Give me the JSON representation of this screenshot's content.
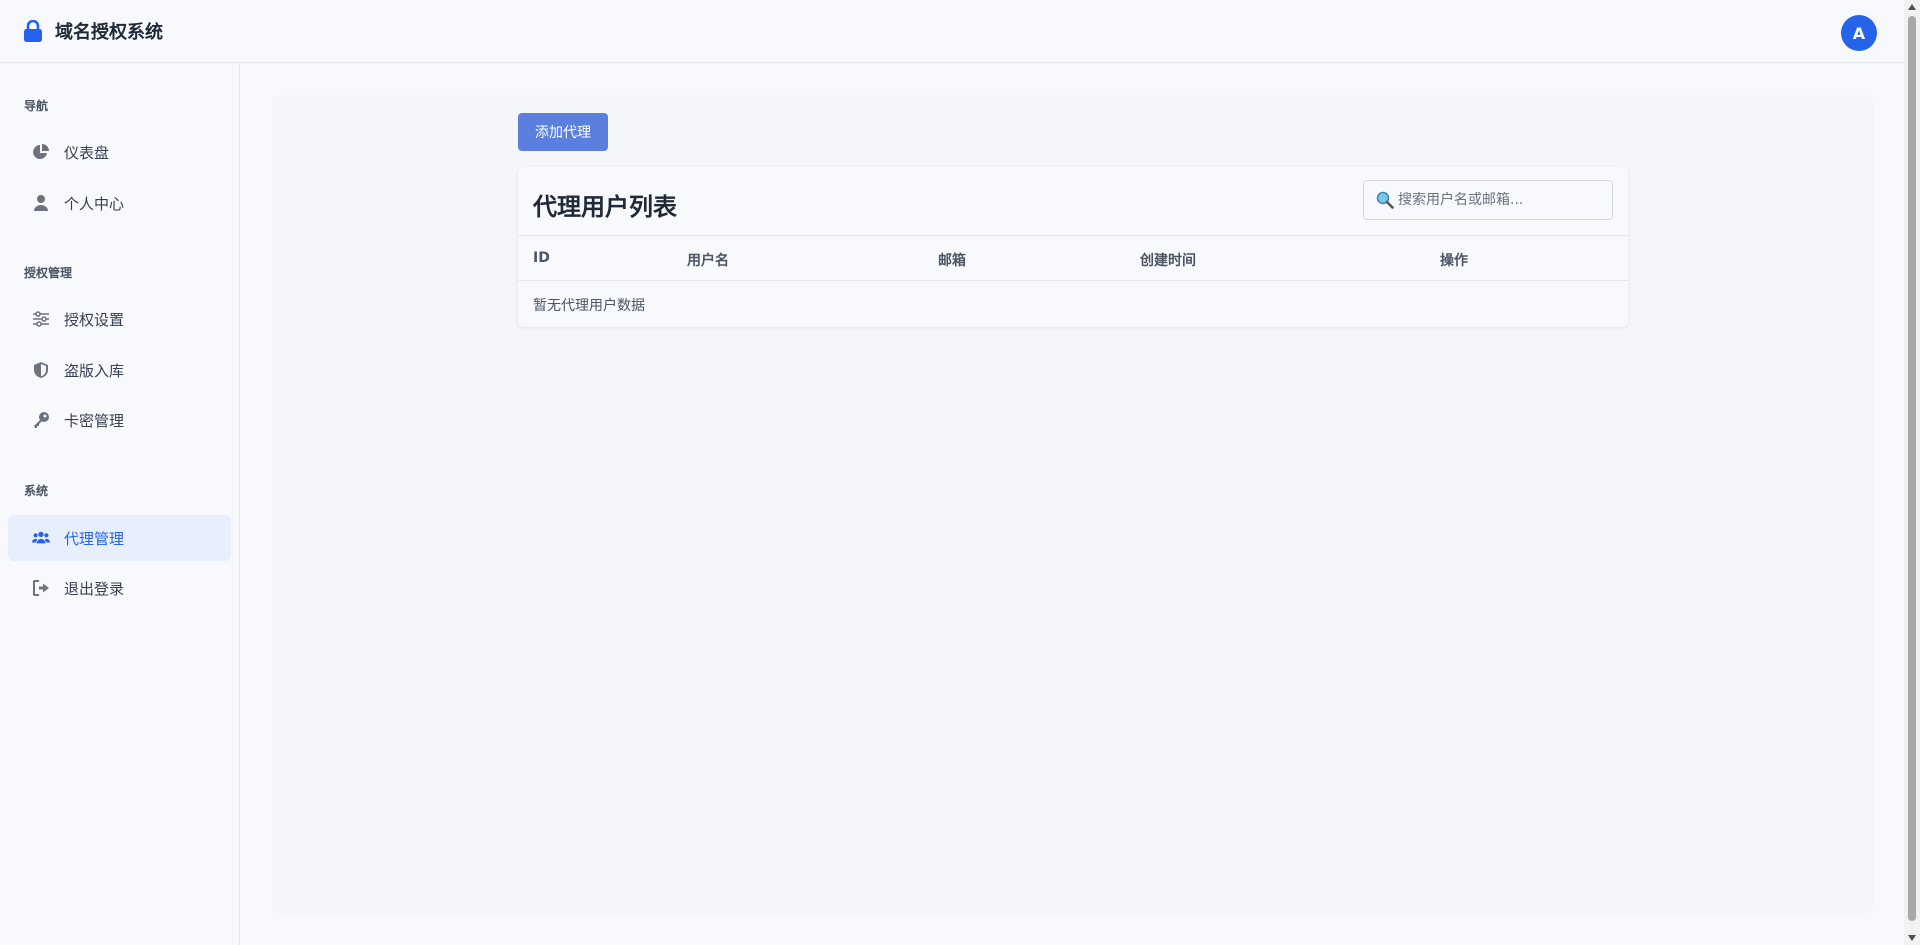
{
  "header": {
    "title": "域名授权系统",
    "brand_icon": "lock-icon",
    "avatar_letter": "A"
  },
  "colors": {
    "accent": "#2563eb",
    "button": "#5b7fdc",
    "active_bg": "#e8effc"
  },
  "sidebar": {
    "sections": [
      {
        "title": "导航",
        "items": [
          {
            "label": "仪表盘",
            "icon": "pie-chart-icon"
          },
          {
            "label": "个人中心",
            "icon": "user-icon"
          }
        ]
      },
      {
        "title": "授权管理",
        "items": [
          {
            "label": "授权设置",
            "icon": "sliders-icon"
          },
          {
            "label": "盗版入库",
            "icon": "shield-icon"
          },
          {
            "label": "卡密管理",
            "icon": "key-icon"
          }
        ]
      },
      {
        "title": "系统",
        "items": [
          {
            "label": "代理管理",
            "icon": "users-icon",
            "active": true
          },
          {
            "label": "退出登录",
            "icon": "sign-out-icon"
          }
        ]
      }
    ]
  },
  "main": {
    "add_button_label": "添加代理",
    "card_title": "代理用户列表",
    "search_placeholder": "搜索用户名或邮箱...",
    "columns": [
      "ID",
      "用户名",
      "邮箱",
      "创建时间",
      "操作"
    ],
    "empty_text": "暂无代理用户数据"
  }
}
